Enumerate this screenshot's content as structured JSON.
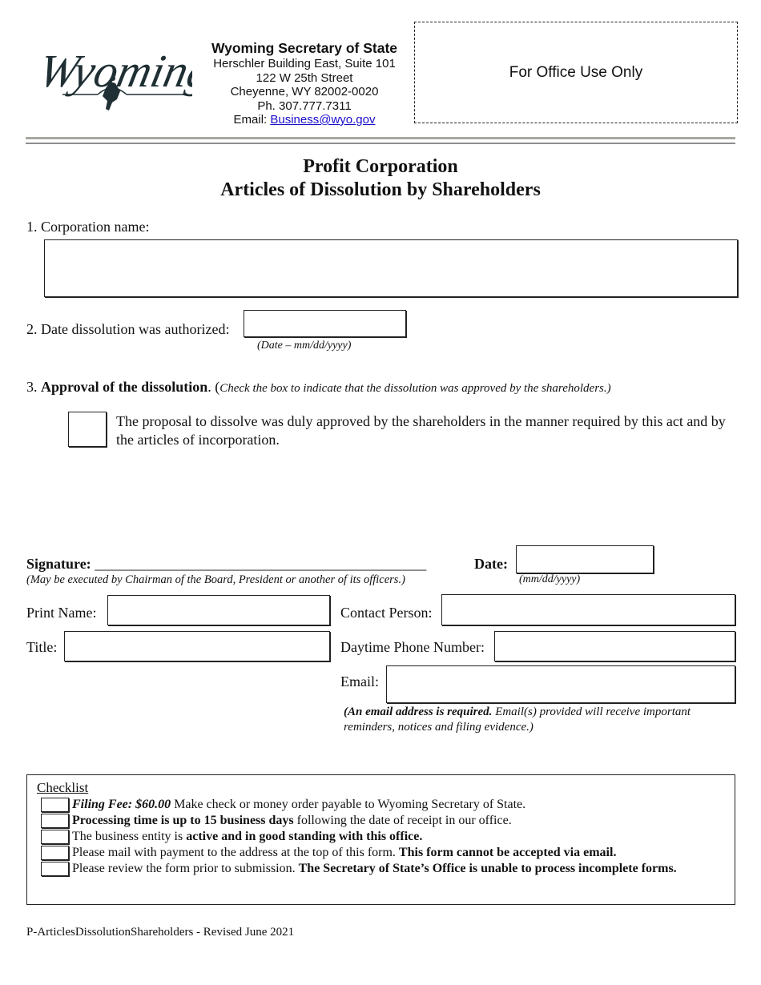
{
  "header": {
    "logo_text": "Wyoming",
    "org_name": "Wyoming Secretary of State",
    "address_line1": "Herschler Building East, Suite 101",
    "address_line2": "122 W 25th Street",
    "address_line3": "Cheyenne, WY 82002-0020",
    "phone": "Ph. 307.777.7311",
    "email_label": "Email: ",
    "email_link": "Business@wyo.gov",
    "office_use": "For Office Use Only"
  },
  "title": {
    "line1": "Profit Corporation",
    "line2": "Articles of Dissolution by Shareholders"
  },
  "section1": {
    "label": "1. Corporation name:",
    "value": ""
  },
  "section2": {
    "label": "2. Date dissolution was authorized:",
    "value": "",
    "hint": "(Date – mm/dd/yyyy)"
  },
  "section3": {
    "number": "3. ",
    "label_bold": "Approval of the dissolution",
    "label_after": ". (",
    "hint": "Check the box to indicate that the dissolution was approved by the shareholders.)",
    "checked": false,
    "statement": "The proposal to dissolve was duly approved by the shareholders in the manner required by this act and by the articles of incorporation."
  },
  "signature": {
    "label": "Signature:",
    "line": "______________________________________________",
    "hint": "(May be executed by Chairman of the Board, President or another of its officers.)",
    "date_label": "Date:",
    "date_value": "",
    "date_hint": "(mm/dd/yyyy)"
  },
  "fields": {
    "print_name_label": "Print Name:",
    "print_name_value": "",
    "title_label": "Title:",
    "title_value": "",
    "contact_label": "Contact Person:",
    "contact_value": "",
    "phone_label": "Daytime Phone Number:",
    "phone_value": "",
    "email_label": "Email:",
    "email_value": "",
    "email_note_bold": "(An email address is required.",
    "email_note_rest": " Email(s) provided will receive important reminders, notices and filing evidence.)"
  },
  "checklist": {
    "title": "Checklist",
    "items": [
      {
        "pre": "",
        "bold": "Filing Fee: $60.00",
        "bold_italic": true,
        "post": " Make check or money order payable to Wyoming Secretary of State.",
        "checked": false
      },
      {
        "pre": "",
        "bold": "Processing time is up to 15 business days",
        "bold_italic": false,
        "post": " following the date of receipt in our office.",
        "checked": false
      },
      {
        "pre": "The business entity is ",
        "bold": "active and in good standing with this office.",
        "bold_italic": false,
        "post": "",
        "checked": false
      },
      {
        "pre": "Please mail with payment to the address at the top of this form. ",
        "bold": "This form cannot be accepted via email.",
        "bold_italic": false,
        "post": "",
        "checked": false
      },
      {
        "pre": "Please review the form prior to submission. ",
        "bold": "The Secretary of State’s Office is unable to process incomplete forms.",
        "bold_italic": false,
        "post": "",
        "checked": false
      }
    ]
  },
  "footer": {
    "text": "P-ArticlesDissolutionShareholders - Revised June 2021"
  }
}
